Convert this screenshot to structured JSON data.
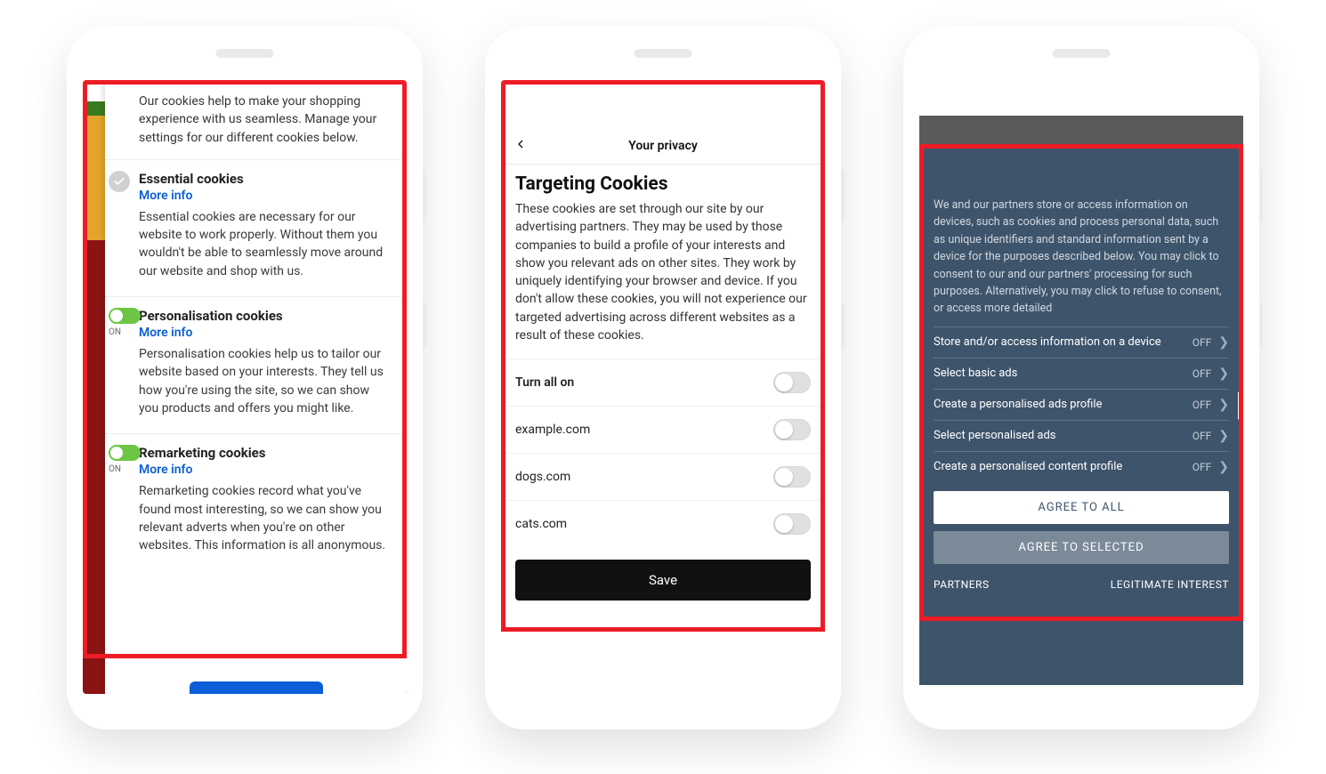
{
  "phone1": {
    "intro": "Our cookies help to make your shopping experience with us seamless. Manage your settings for our different cookies below.",
    "sections": [
      {
        "title": "Essential cookies",
        "more": "More info",
        "body": "Essential cookies are necessary for our website to work properly. Without them you wouldn't be able to seamlessly move around our website and shop with us."
      },
      {
        "title": "Personalisation cookies",
        "on": "ON",
        "more": "More info",
        "body": "Personalisation cookies help us to tailor our website based on your interests. They tell us how you're using the site, so we can show you products and offers you might like."
      },
      {
        "title": "Remarketing cookies",
        "on": "ON",
        "more": "More info",
        "body": "Remarketing cookies record what you've found most interesting, so we can show you relevant adverts when you're on other websites. This information is all anonymous."
      }
    ]
  },
  "phone2": {
    "header_title": "Your privacy",
    "heading": "Targeting Cookies",
    "desc": "These cookies are set through our site by our advertising partners. They may be used by those companies to build a profile of your interests and show you relevant ads on other sites. They work by uniquely identifying your browser and device. If you don't allow these cookies, you will not experience our targeted advertising across different websites as a result of these cookies.",
    "rows": [
      {
        "label": "Turn all on"
      },
      {
        "label": "example.com"
      },
      {
        "label": "dogs.com"
      },
      {
        "label": "cats.com"
      }
    ],
    "save": "Save"
  },
  "phone3": {
    "intro": "We and our partners store or access information on devices, such as cookies and process personal data, such as unique identifiers and standard information sent by a device for the purposes described below. You may click to consent to our and our partners' processing for such purposes. Alternatively, you may click to refuse to consent, or access more detailed",
    "items": [
      {
        "label": "Store and/or access information on a device",
        "state": "OFF"
      },
      {
        "label": "Select basic ads",
        "state": "OFF"
      },
      {
        "label": "Create a personalised ads profile",
        "state": "OFF"
      },
      {
        "label": "Select personalised ads",
        "state": "OFF"
      },
      {
        "label": "Create a personalised content profile",
        "state": "OFF"
      }
    ],
    "agree_all": "AGREE TO ALL",
    "agree_selected": "AGREE TO SELECTED",
    "footer_left": "PARTNERS",
    "footer_right": "LEGITIMATE INTEREST"
  }
}
